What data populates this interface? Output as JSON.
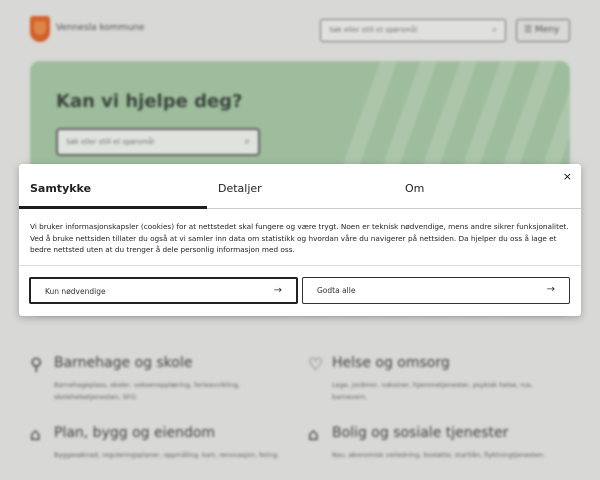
{
  "header": {
    "brand": "Vennesla kommune",
    "search_placeholder": "Søk eller still et spørsmål",
    "menu_label": "Meny"
  },
  "hero": {
    "title": "Kan vi hjelpe deg?",
    "search_placeholder": "Søk eller still et spørsmål"
  },
  "categories": [
    {
      "title": "Barnehage og skole",
      "desc": "Barnehageplass, skoler, voksenopplæring, ferieavvikling, skolehelsetjenesten, SFO.",
      "icon": "stroller-icon"
    },
    {
      "title": "Helse og omsorg",
      "desc": "Lege, jordmor, vaksiner, hjemmetjenester, psykisk helse, rus, barnevern.",
      "icon": "heart-icon"
    },
    {
      "title": "Plan, bygg og eiendom",
      "desc": "Byggesøknad, reguleringsplaner, oppmåling, kart, renovasjon, feiing.",
      "icon": "building-icon"
    },
    {
      "title": "Bolig og sosiale tjenester",
      "desc": "Nav, økonomisk veiledning, bostøtte, startlån, flyktningtjenesten.",
      "icon": "house-icon"
    }
  ],
  "dialog": {
    "tabs": [
      "Samtykke",
      "Detaljer",
      "Om"
    ],
    "active_tab": "Samtykke",
    "close_label": "×",
    "text_line1": "Vi bruker informasjonskapsler (cookies) for at nettstedet skal fungere og være trygt. Noen er teknisk nødvendige, mens andre sikrer funksjonalitet.",
    "text_line2": "Ved å bruke nettsiden tillater du også at vi samler inn data om statistikk og hvordan våre du navigerer på nettsiden. Da hjelper du oss å lage et bedre nettsted uten at du trenger å dele personlig informasjon med oss.",
    "btn_necessary": "Kun nødvendige",
    "btn_accept_all": "Godta alle",
    "arrow": "→"
  },
  "colors": {
    "hero_bg": "#a8c9a7",
    "logo": "#e0672e",
    "dialog_bg": "#ffffff"
  }
}
